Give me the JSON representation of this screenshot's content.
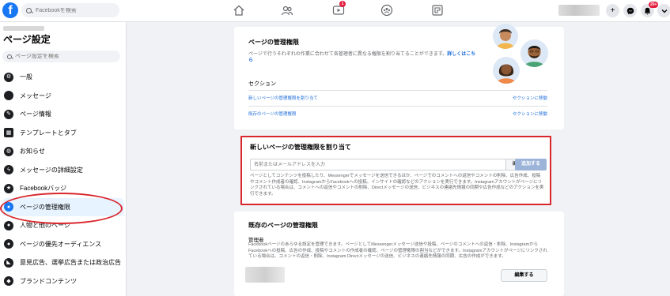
{
  "topbar": {
    "logo": "f",
    "search_placeholder": "Facebookを検索",
    "nav_icons": [
      "home-icon",
      "friends-icon",
      "watch-icon",
      "groups-icon",
      "gaming-icon"
    ],
    "watch_badge": "1",
    "notif_badge": "20+",
    "plus": "+"
  },
  "sidebar": {
    "title": "ページ設定",
    "search_placeholder": "ページ設定を検索",
    "items": [
      {
        "label": "一般",
        "icon": "gear-icon"
      },
      {
        "label": "メッセージ",
        "icon": "message-icon"
      },
      {
        "label": "ページ情報",
        "icon": "edit-icon"
      },
      {
        "label": "テンプレートとタブ",
        "icon": "grid-icon"
      },
      {
        "label": "お知らせ",
        "icon": "globe-icon"
      },
      {
        "label": "メッセージの詳細設定",
        "icon": "messenger-icon"
      },
      {
        "label": "Facebookバッジ",
        "icon": "facebook-icon"
      },
      {
        "label": "ページの管理権限",
        "icon": "person-icon",
        "active": true
      },
      {
        "label": "人物と他のページ",
        "icon": "people-icon"
      },
      {
        "label": "ページの優先オーディエンス",
        "icon": "audience-icon"
      },
      {
        "label": "意見広告、選挙広告または政治広告",
        "icon": "megaphone-icon"
      },
      {
        "label": "ブランドコンテンツ",
        "icon": "handshake-icon"
      }
    ]
  },
  "card1": {
    "title": "ページの管理権限",
    "desc": "ページで行うそれぞれの作業に合わせて各管理者に異なる権限を割り当てることができます。",
    "more_link": "詳しくはこちら",
    "section_label": "セクション",
    "rows": [
      {
        "left": "新しいページの管理権限を割り当て",
        "right": "セクションに移動"
      },
      {
        "left": "既存のページの管理権限",
        "right": "セクションに移動"
      }
    ]
  },
  "card2": {
    "title": "新しいページの管理権限を割り当て",
    "input_placeholder": "名前またはメールアドレスを入力",
    "role": "編集者 ▾",
    "add_button": "追加する",
    "desc": "ページとしてコンテンツを投稿したり、Messengerでメッセージを送信できるほか、ページでのコメントへの返信やコメントの削除、広告作成、投稿やコメント作成者の確認、InstagramからFacebookへの投稿、インサイトの確認などのアクションを実行できます。Instagramアカウントがページにリンクされている場合は、コメントへの返信やコメントの削除、Directメッセージの送信、ビジネスの連絡先情報の同期や広告作成などのアクションを実行できます。"
  },
  "card3": {
    "title": "既存のページの管理権限",
    "role_label": "管理者",
    "desc": "Facebookページのあらゆる設定を管理できます。ページとしてMessengerメッセージ送信や投稿、ページのコメントへの返信・削除、InstagramからFacebookへの投稿、広告の作成、投稿やコメントの作成者の確認、ページの管理権限の割当などができます。Instagramアカウントがページにリンクされている場合は、コメントの返信・削除、Instagram Directメッセージの送信、ビジネスの連絡先情報の同期、広告の作成ができます。",
    "edit_button": "編集する"
  }
}
